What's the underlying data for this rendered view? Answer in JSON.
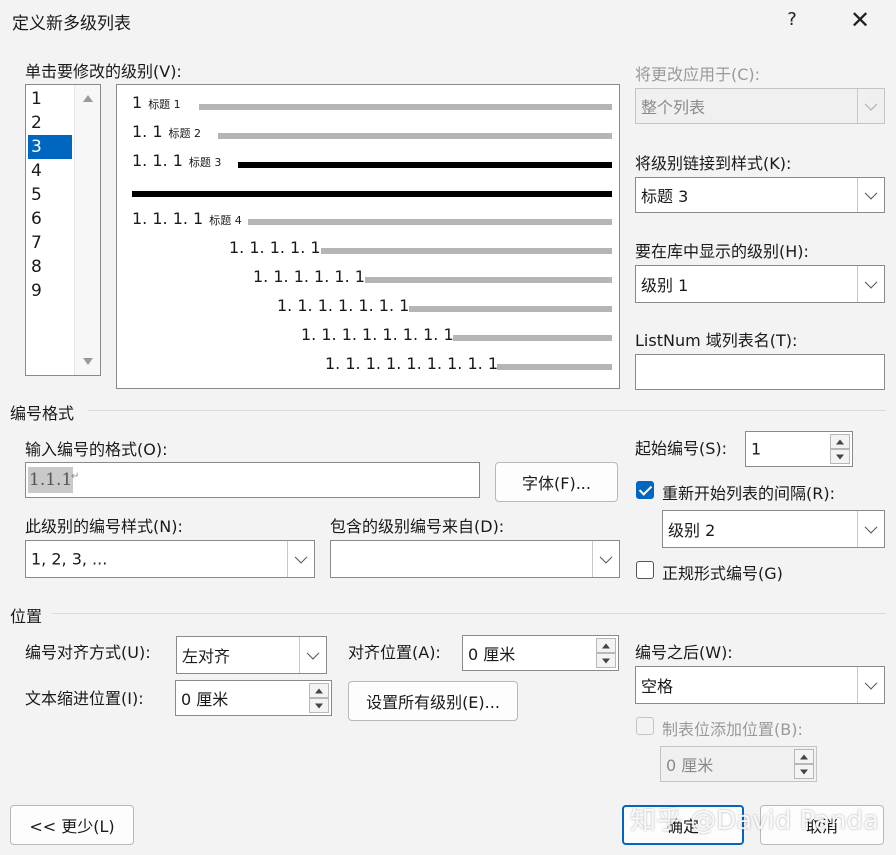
{
  "window": {
    "title": "定义新多级列表",
    "help": "?",
    "close": "✕"
  },
  "level_section": {
    "label": "单击要修改的级别(V):",
    "levels": [
      "1",
      "2",
      "3",
      "4",
      "5",
      "6",
      "7",
      "8",
      "9"
    ],
    "selected": "3"
  },
  "preview": {
    "rows": [
      {
        "num": "1",
        "style": "标题 1"
      },
      {
        "num": "1. 1",
        "style": "标题 2"
      },
      {
        "num": "1. 1. 1",
        "style": "标题 3"
      },
      {
        "num": "1. 1. 1. 1",
        "style": "标题 4"
      },
      {
        "num": "1. 1. 1. 1. 1",
        "style": ""
      },
      {
        "num": "1. 1. 1. 1. 1. 1",
        "style": ""
      },
      {
        "num": "1. 1. 1. 1. 1. 1. 1",
        "style": ""
      },
      {
        "num": "1. 1. 1. 1. 1. 1. 1. 1",
        "style": ""
      },
      {
        "num": "1. 1. 1. 1. 1. 1. 1. 1. 1",
        "style": ""
      }
    ]
  },
  "right_panel": {
    "apply_to_label": "将更改应用于(C):",
    "apply_to_value": "整个列表",
    "link_style_label": "将级别链接到样式(K):",
    "link_style_value": "标题 3",
    "gallery_level_label": "要在库中显示的级别(H):",
    "gallery_level_value": "级别 1",
    "listnum_label": "ListNum 域列表名(T):",
    "listnum_value": ""
  },
  "number_format": {
    "section_title": "编号格式",
    "format_label": "输入编号的格式(O):",
    "format_value": "1.1.1",
    "format_mark": "↵",
    "font_button": "字体(F)...",
    "style_label": "此级别的编号样式(N):",
    "style_value": "1, 2, 3, ...",
    "include_label": "包含的级别编号来自(D):",
    "include_value": "",
    "start_label": "起始编号(S):",
    "start_value": "1",
    "restart_label": "重新开始列表的间隔(R):",
    "restart_checked": true,
    "restart_value": "级别 2",
    "legal_label": "正规形式编号(G)",
    "legal_checked": false
  },
  "position": {
    "section_title": "位置",
    "align_label": "编号对齐方式(U):",
    "align_value": "左对齐",
    "align_at_label": "对齐位置(A):",
    "align_at_value": "0 厘米",
    "indent_label": "文本缩进位置(I):",
    "indent_value": "0 厘米",
    "set_all_button": "设置所有级别(E)...",
    "follow_label": "编号之后(W):",
    "follow_value": "空格",
    "tab_stop_label": "制表位添加位置(B):",
    "tab_stop_value": "0 厘米"
  },
  "footer": {
    "less_button": "<< 更少(L)",
    "ok_button": "确定",
    "cancel_button": "取消",
    "watermark": "知乎 @David Panda"
  }
}
